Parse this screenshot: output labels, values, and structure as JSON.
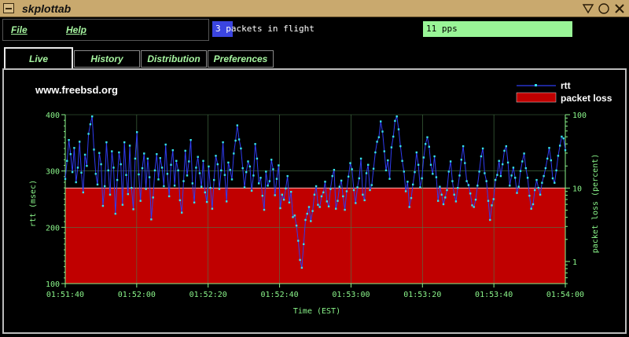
{
  "window": {
    "title": "skplottab"
  },
  "menu": {
    "file": "File",
    "help": "Help"
  },
  "status": {
    "packets_in_flight_text": "3 packets in flight",
    "packets_in_flight_value": 3,
    "packets_in_flight_fraction": 0.1,
    "pps_text": "11 pps"
  },
  "tabs": [
    {
      "label": "Live",
      "active": true
    },
    {
      "label": "History",
      "active": false
    },
    {
      "label": "Distribution",
      "active": false
    },
    {
      "label": "Preferences",
      "active": false
    }
  ],
  "colors": {
    "accent_green": "#a6f5a0",
    "rtt_line": "#2f3cf0",
    "rtt_marker": "#35e0e8",
    "packet_loss_fill": "#c00000",
    "status_blue": "#3b45e0",
    "pps_bar": "#99f597"
  },
  "chart_data": {
    "type": "line",
    "title": "www.freebsd.org",
    "xlabel": "Time (EST)",
    "ylabel": "rtt (msec)",
    "y2label": "packet loss (percent)",
    "xticks": [
      "01:51:40",
      "01:52:00",
      "01:52:20",
      "01:52:40",
      "01:53:00",
      "01:53:20",
      "01:53:40",
      "01:54:00"
    ],
    "yticks": [
      100,
      200,
      300,
      400
    ],
    "ylim": [
      100,
      400
    ],
    "y2ticks": [
      1,
      10,
      100
    ],
    "y2lim": [
      0.5,
      100
    ],
    "y2scale": "log",
    "grid": true,
    "legend_position": "top-right",
    "series": [
      {
        "name": "rtt",
        "style": "line+markers",
        "values": [
          286,
          318,
          355,
          330,
          298,
          341,
          280,
          306,
          352,
          297,
          262,
          329,
          309,
          366,
          383,
          397,
          338,
          295,
          276,
          332,
          312,
          238,
          273,
          351,
          301,
          258,
          335,
          306,
          224,
          284,
          333,
          312,
          240,
          351,
          293,
          259,
          345,
          270,
          232,
          322,
          369,
          294,
          247,
          305,
          331,
          268,
          322,
          289,
          214,
          253,
          301,
          330,
          285,
          323,
          306,
          273,
          347,
          295,
          255,
          311,
          337,
          274,
          318,
          301,
          248,
          226,
          282,
          336,
          292,
          317,
          355,
          278,
          244,
          306,
          325,
          296,
          272,
          318,
          262,
          245,
          308,
          270,
          233,
          284,
          327,
          312,
          268,
          301,
          351,
          293,
          246,
          315,
          302,
          285,
          331,
          354,
          381,
          356,
          340,
          305,
          271,
          298,
          317,
          308,
          265,
          292,
          348,
          322,
          278,
          288,
          256,
          231,
          299,
          274,
          282,
          320,
          303,
          257,
          286,
          310,
          234,
          258,
          249,
          269,
          291,
          244,
          263,
          218,
          221,
          203,
          176,
          142,
          128,
          170,
          213,
          224,
          236,
          211,
          229,
          258,
          273,
          240,
          236,
          255,
          262,
          281,
          246,
          237,
          268,
          291,
          302,
          233,
          247,
          272,
          283,
          255,
          231,
          264,
          290,
          314,
          303,
          266,
          243,
          271,
          287,
          322,
          258,
          248,
          296,
          311,
          266,
          275,
          304,
          333,
          352,
          360,
          388,
          370,
          335,
          301,
          319,
          286,
          342,
          361,
          389,
          397,
          374,
          344,
          318,
          299,
          264,
          281,
          236,
          252,
          276,
          298,
          333,
          311,
          271,
          287,
          324,
          348,
          360,
          343,
          311,
          295,
          326,
          289,
          247,
          272,
          258,
          241,
          253,
          266,
          299,
          317,
          282,
          258,
          246,
          270,
          292,
          320,
          344,
          314,
          282,
          275,
          260,
          239,
          236,
          249,
          274,
          299,
          326,
          340,
          296,
          282,
          247,
          213,
          239,
          250,
          284,
          293,
          318,
          291,
          312,
          336,
          344,
          315,
          274,
          292,
          306,
          288,
          261,
          272,
          300,
          317,
          331,
          305,
          288,
          256,
          233,
          241,
          266,
          284,
          270,
          258,
          279,
          291,
          305,
          322,
          341,
          319,
          287,
          279,
          301,
          327,
          345,
          361,
          358,
          337
        ]
      },
      {
        "name": "packet loss",
        "style": "area",
        "units": "percent",
        "value": 10
      }
    ]
  }
}
